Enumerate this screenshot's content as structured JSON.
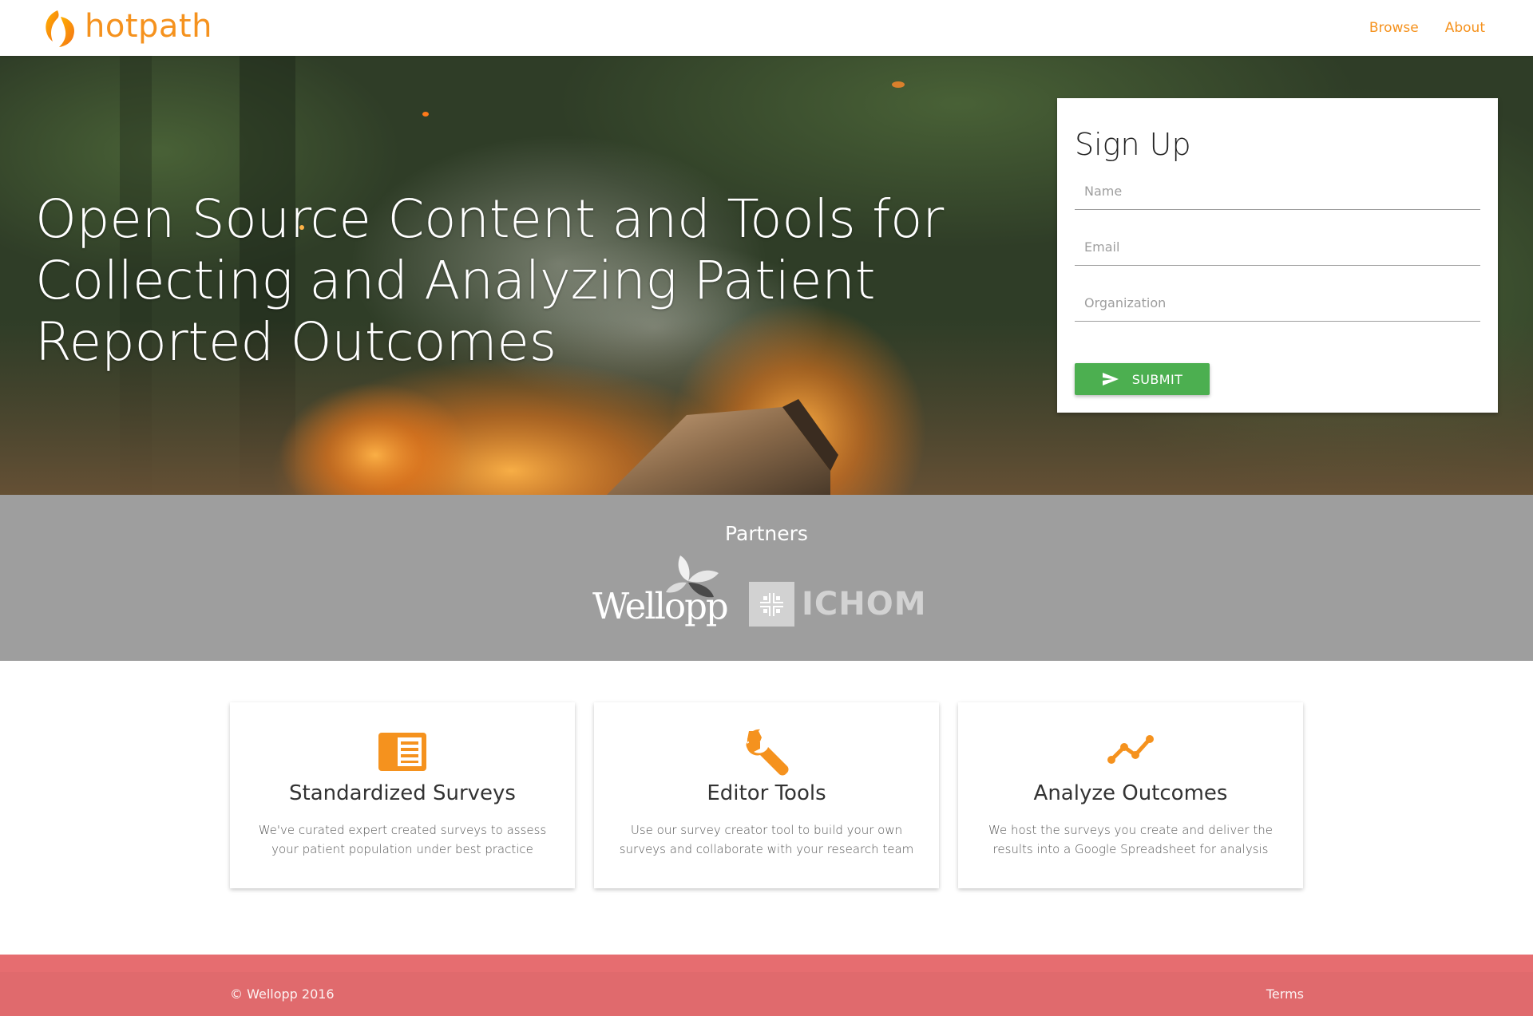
{
  "brand": {
    "name": "hotpath",
    "icon": "flame-logo-icon",
    "color": "#f5921e"
  },
  "nav": {
    "links": [
      {
        "label": "Browse"
      },
      {
        "label": "About"
      }
    ]
  },
  "hero": {
    "title": "Open Source Content and Tools for Collecting and Analyzing Patient Reported Outcomes",
    "background": "campfire-photo"
  },
  "signup": {
    "title": "Sign Up",
    "fields": [
      {
        "placeholder": "Name",
        "value": ""
      },
      {
        "placeholder": "Email",
        "value": ""
      },
      {
        "placeholder": "Organization",
        "value": ""
      }
    ],
    "submit": {
      "label": "SUBMIT",
      "icon": "send-icon",
      "color": "#4caf50"
    }
  },
  "partners": {
    "title": "Partners",
    "logos": [
      {
        "name": "Wellopp",
        "icon": "wellopp-leaves-icon"
      },
      {
        "name": "ICHOM",
        "icon": "ichom-cross-icon"
      }
    ]
  },
  "features": [
    {
      "icon": "survey-list-icon",
      "title": "Standardized Surveys",
      "text": "We've curated expert created surveys to assess your patient population under best practice"
    },
    {
      "icon": "wrench-icon",
      "title": "Editor Tools",
      "text": "Use our survey creator tool to build your own surveys and collaborate with your research team"
    },
    {
      "icon": "trending-line-icon",
      "title": "Analyze Outcomes",
      "text": "We host the surveys you create and deliver the results into a Google Spreadsheet for analysis"
    }
  ],
  "footer": {
    "copyright": "© Wellopp 2016",
    "terms": "Terms",
    "color": "#e06a6d"
  }
}
